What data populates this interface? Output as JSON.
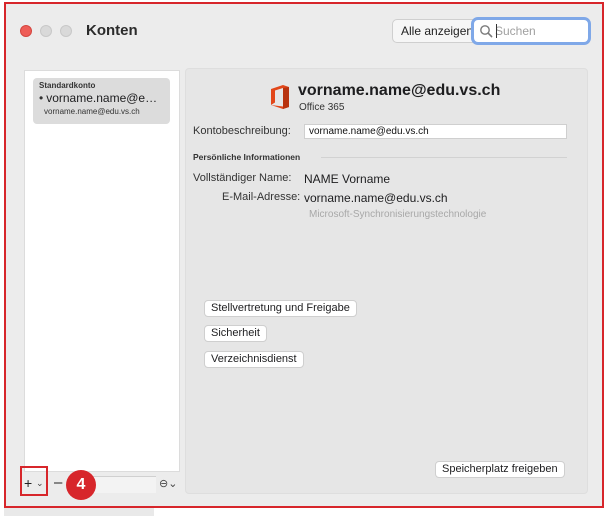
{
  "window": {
    "title": "Konten"
  },
  "toolbar": {
    "show_all_label": "Alle anzeigen",
    "search_placeholder": "Suchen",
    "search_icon": "magnifier-icon"
  },
  "sidebar": {
    "account": {
      "label": "Standardkonto",
      "bullet": "•",
      "name": "vorname.name@e…",
      "email": "vorname.name@edu.vs.ch"
    },
    "bottom": {
      "add": "+",
      "add_menu": "⌄",
      "remove": "–",
      "more": "⊖⌄"
    }
  },
  "annotation": {
    "step_number": "4",
    "color": "#d7262b"
  },
  "detail": {
    "icon": "office-365-icon",
    "header_email": "vorname.name@edu.vs.ch",
    "account_type": "Office 365",
    "description_label": "Kontobeschreibung:",
    "description_value": "vorname.name@edu.vs.ch",
    "section_title": "Persönliche Informationen",
    "full_name_label": "Vollständiger Name:",
    "full_name_value": "NAME Vorname",
    "email_label": "E-Mail-Adresse:",
    "email_value": "vorname.name@edu.vs.ch",
    "technology": "Microsoft-Synchronisierungstechnologie",
    "buttons": {
      "delegation": "Stellvertretung und Freigabe",
      "security": "Sicherheit",
      "directory": "Verzeichnisdienst",
      "free_storage": "Speicherplatz freigeben"
    }
  },
  "colors": {
    "close": "#ee5d57",
    "office_red": "#e2471a",
    "focus_ring": "#7fa8e8"
  }
}
